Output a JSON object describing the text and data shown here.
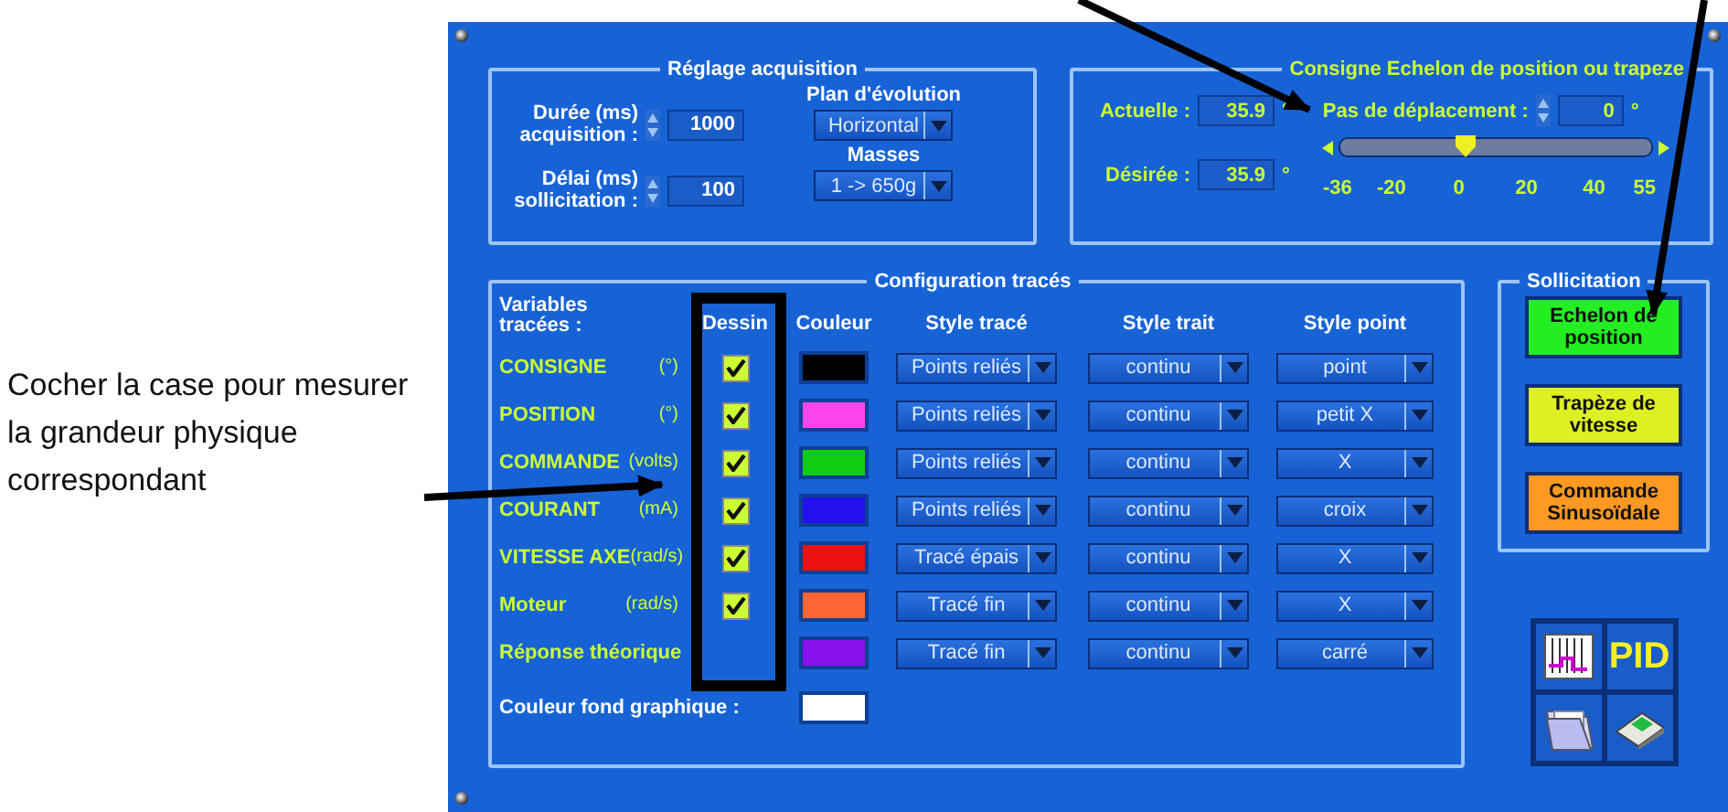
{
  "annotation": {
    "text": "Cocher la case pour mesurer la grandeur physique correspondant"
  },
  "acquisition": {
    "title": "Réglage acquisition",
    "fields": [
      {
        "label": "Durée (ms) acquisition :",
        "value": "1000"
      },
      {
        "label": "Délai (ms) sollicitation :",
        "value": "100"
      }
    ],
    "selects": [
      {
        "label": "Plan d'évolution",
        "value": "Horizontal"
      },
      {
        "label": "Masses",
        "value": "1 -> 650g"
      }
    ]
  },
  "consigne": {
    "title": "Consigne Echelon de position ou trapeze",
    "readings": [
      {
        "label": "Actuelle :",
        "value": "35.9",
        "unit": "°"
      },
      {
        "label": "Désirée :",
        "value": "35.9",
        "unit": "°"
      }
    ],
    "step": {
      "label": "Pas de déplacement :",
      "value": "0",
      "unit": "°"
    },
    "slider": {
      "level": 0.396,
      "ticks": [
        "-36",
        "-20",
        "0",
        "20",
        "40",
        "55"
      ]
    }
  },
  "config": {
    "title": "Configuration tracés",
    "headers": [
      "Variables tracées :",
      "Dessin",
      "Couleur",
      "Style tracé",
      "Style trait",
      "Style point"
    ],
    "rows": [
      {
        "name": "CONSIGNE",
        "unit": "(°)",
        "checked": true,
        "color": "#000000",
        "trace": "Points reliés",
        "trait": "continu",
        "point": "point"
      },
      {
        "name": "POSITION",
        "unit": "(°)",
        "checked": true,
        "color": "#ff44ee",
        "trace": "Points reliés",
        "trait": "continu",
        "point": "petit X"
      },
      {
        "name": "COMMANDE",
        "unit": "(volts)",
        "checked": true,
        "color": "#11cc11",
        "trace": "Points reliés",
        "trait": "continu",
        "point": "X"
      },
      {
        "name": "COURANT",
        "unit": "(mA)",
        "checked": true,
        "color": "#2211ee",
        "trace": "Points reliés",
        "trait": "continu",
        "point": "croix"
      },
      {
        "name": "VITESSE AXE",
        "unit": "(rad/s)",
        "checked": true,
        "color": "#ee1111",
        "trace": "Tracé épais",
        "trait": "continu",
        "point": "X"
      },
      {
        "name": "Moteur",
        "unit": "(rad/s)",
        "checked": true,
        "color": "#ff6633",
        "trace": "Tracé fin",
        "trait": "continu",
        "point": "X"
      },
      {
        "name": "Réponse théorique",
        "color": "#8811ee",
        "trace": "Tracé fin",
        "trait": "continu",
        "point": "carré"
      }
    ],
    "background": {
      "label": "Couleur fond graphique :",
      "color": "#ffffff"
    }
  },
  "solicitation": {
    "title": "Sollicitation",
    "buttons": [
      {
        "label": "Echelon de position",
        "color": "#22ee22"
      },
      {
        "label": "Trapèze de vitesse",
        "color": "#ddf022"
      },
      {
        "label": "Commande Sinusoïdale",
        "color": "#ff9922"
      }
    ]
  },
  "tools": [
    {
      "kind": "chart"
    },
    {
      "kind": "text",
      "label": "PID"
    },
    {
      "kind": "folder"
    },
    {
      "kind": "calculator"
    }
  ]
}
